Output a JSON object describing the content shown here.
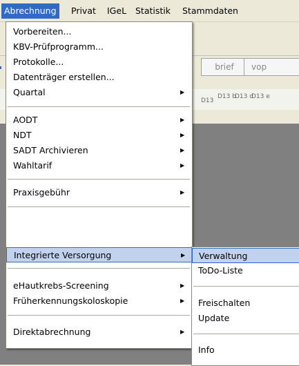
{
  "menubar": {
    "items": [
      "Abrechnung",
      "Privat",
      "IGeL",
      "Statistik",
      "Stammdaten"
    ]
  },
  "background": {
    "tabs": [
      "brief",
      "vop"
    ],
    "dental_labels": [
      "D13",
      "D13 b",
      "D13 d",
      "D13 e"
    ]
  },
  "menu": {
    "items": [
      {
        "label": "Vorbereiten...",
        "submenu": false
      },
      {
        "label": "KBV-Prüfprogramm...",
        "submenu": false
      },
      {
        "label": "Protokolle...",
        "submenu": false
      },
      {
        "label": "Datenträger erstellen...",
        "submenu": false
      },
      {
        "label": "Quartal",
        "submenu": true
      },
      {
        "label": "AODT",
        "submenu": true
      },
      {
        "label": "NDT",
        "submenu": true
      },
      {
        "label": "SADT Archivieren",
        "submenu": true
      },
      {
        "label": "Wahltarif",
        "submenu": true
      },
      {
        "label": "Praxisgebühr",
        "submenu": true
      },
      {
        "label": "Integrierte Versorgung",
        "submenu": true
      },
      {
        "label": "eHautkrebs-Screening",
        "submenu": true
      },
      {
        "label": "Früherkennungskoloskopie",
        "submenu": true
      },
      {
        "label": "Direktabrechnung",
        "submenu": true
      }
    ]
  },
  "submenu": {
    "items": [
      "Verwaltung",
      "ToDo-Liste",
      "Freischalten",
      "Update",
      "Info"
    ]
  }
}
